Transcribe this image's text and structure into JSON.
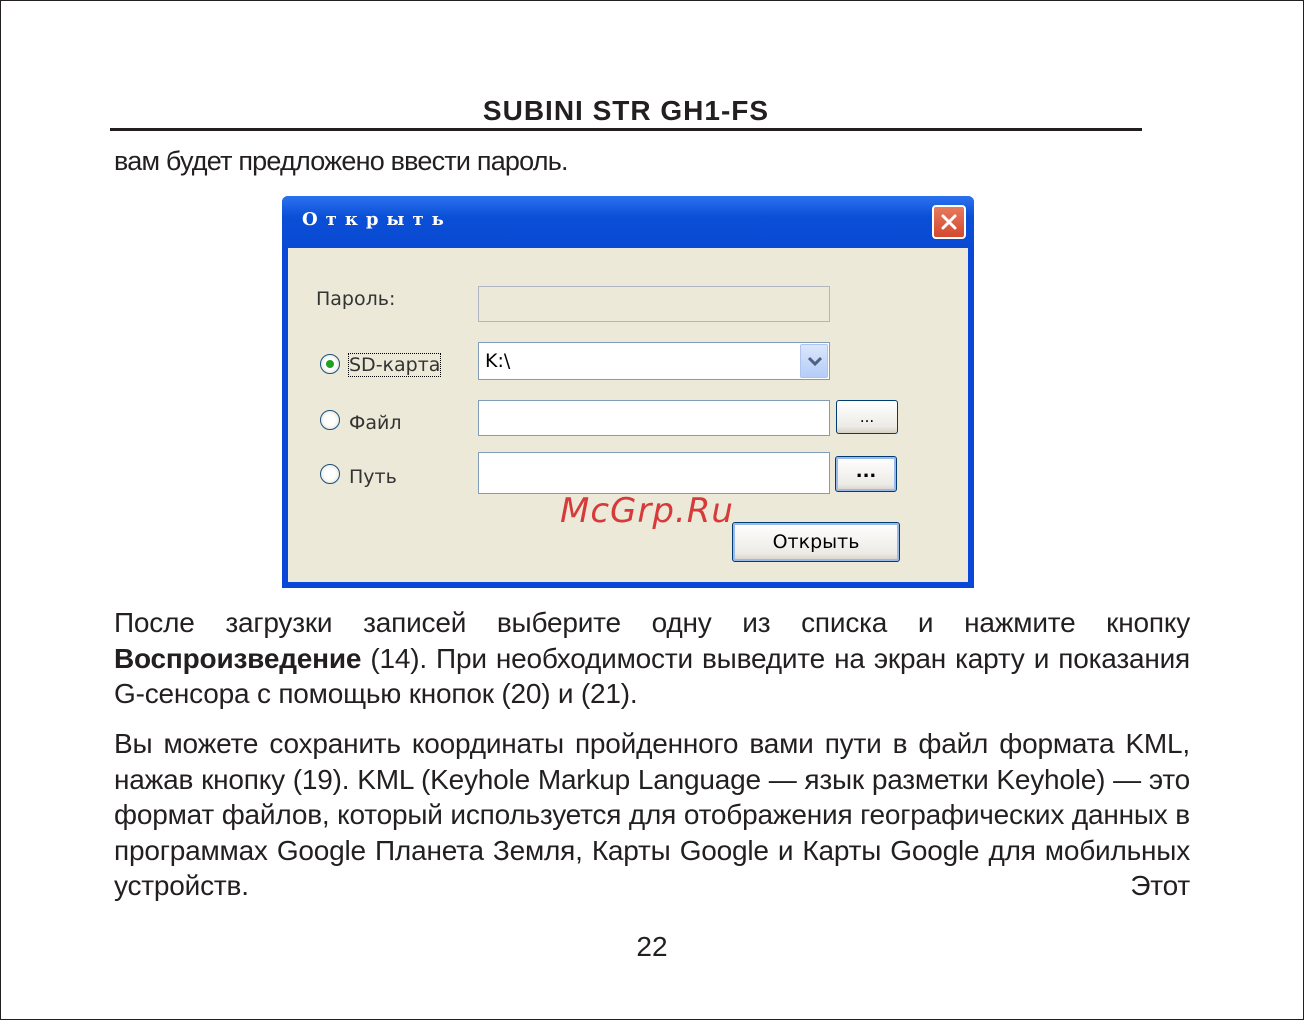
{
  "header": {
    "title": "SUBINI STR GH1-FS"
  },
  "intro_text": "вам будет предложено ввести пароль.",
  "dialog": {
    "title": "Открыть",
    "password_label": "Пароль:",
    "password_value": "",
    "options": [
      {
        "label": "SD-карта",
        "selected": true
      },
      {
        "label": "Файл",
        "selected": false
      },
      {
        "label": "Путь",
        "selected": false
      }
    ],
    "sd_value": "K:\\",
    "file_value": "",
    "path_value": "",
    "browse_label": "...",
    "open_button": "Открыть"
  },
  "watermark": "McGrp.Ru",
  "paragraph1": {
    "part1": "После загрузки записей выберите одну из списка и нажмите кнопку ",
    "bold": "Воспроизведение",
    "part2": " (14). При необходимости выведите на экран карту и показания G-сенсора с помощью кнопок (20) и (21)."
  },
  "paragraph2": "Вы можете сохранить координаты пройденного вами пути в файл формата KML, нажав кнопку (19). KML (Keyhole Markup Language — язык разметки Keyhole) — это формат файлов, который используется для отображения географических данных в программах Google Планета Земля, Карты Google и Карты Google для мобильных устройств. Этот",
  "page_number": "22"
}
